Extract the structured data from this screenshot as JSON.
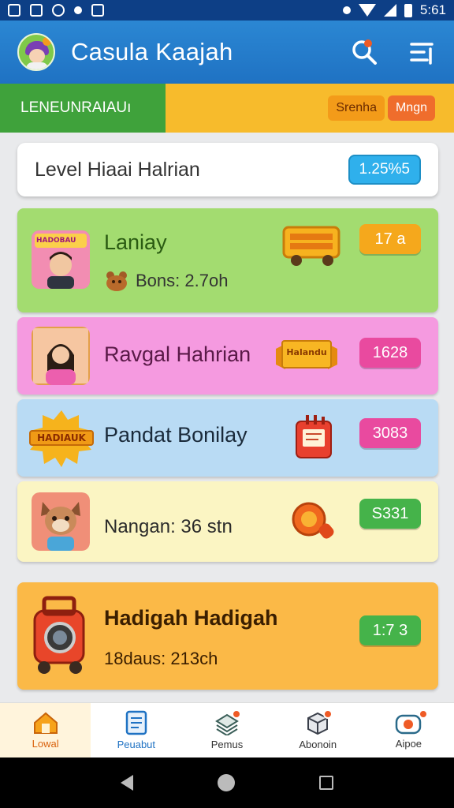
{
  "status_bar": {
    "time": "5:61"
  },
  "app_bar": {
    "title": "Casula Kaajah"
  },
  "banner": {
    "left_text": "LENEUNRAIAUı",
    "chip_a": "Srenha",
    "chip_b": "Mngn"
  },
  "level": {
    "text": "Level Hiaai Halrian",
    "badge": "1.25%5"
  },
  "cards": [
    {
      "title": "Laniay",
      "subtitle": "Bons: 2.7oh",
      "score": "17 a",
      "thumb_text": "HADOBAU",
      "colors": {
        "score_bg": "#f5a81c"
      }
    },
    {
      "title": "Ravgal Hahrian",
      "subtitle": "",
      "score": "1628",
      "badge_text": "Halandu",
      "colors": {
        "score_bg": "#e94a9f"
      }
    },
    {
      "title": "Pandat Bonilay",
      "subtitle": "",
      "score": "3083",
      "thumb_text": "HADIAUK",
      "colors": {
        "score_bg": "#e94a9f"
      }
    },
    {
      "title": "",
      "subtitle": "Nangan: 36 stn",
      "score": "S331",
      "colors": {
        "score_bg": "#45b34a"
      }
    },
    {
      "title": "Hadigah Hadigah",
      "subtitle": "18daus: 213ch",
      "score": "1:7 3",
      "colors": {
        "score_bg": "#45b34a"
      }
    }
  ],
  "bottom_nav": [
    {
      "label": "Lowal",
      "icon": "home-icon"
    },
    {
      "label": "Peuabut",
      "icon": "document-icon"
    },
    {
      "label": "Pemus",
      "icon": "stack-icon"
    },
    {
      "label": "Abonoin",
      "icon": "box-icon"
    },
    {
      "label": "Aipoe",
      "icon": "camera-icon"
    }
  ]
}
